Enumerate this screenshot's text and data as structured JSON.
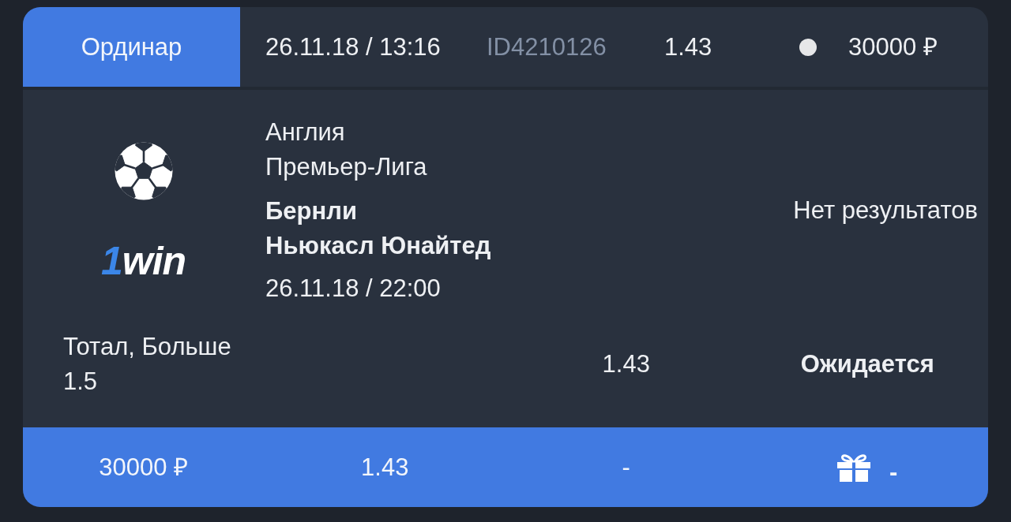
{
  "header": {
    "bet_type": "Ординар",
    "placed_at": "26.11.18 / 13:16",
    "bet_id": "ID4210126",
    "odds": "1.43",
    "amount": "30000 ₽"
  },
  "event": {
    "country": "Англия",
    "league": "Премьер-Лига",
    "teams": [
      "Бернли",
      "Ньюкасл Юнайтед"
    ],
    "start_time": "26.11.18 / 22:00",
    "result": "Нет результатов",
    "brand_logo": "1win"
  },
  "selection": {
    "market": "Тотал, Больше 1.5",
    "odds": "1.43",
    "status": "Ожидается"
  },
  "summary": [
    {
      "kind": "text",
      "text": "30000 ₽"
    },
    {
      "kind": "text",
      "text": "1.43"
    },
    {
      "kind": "text",
      "text": "-"
    },
    {
      "kind": "gift",
      "text": "-"
    }
  ]
}
